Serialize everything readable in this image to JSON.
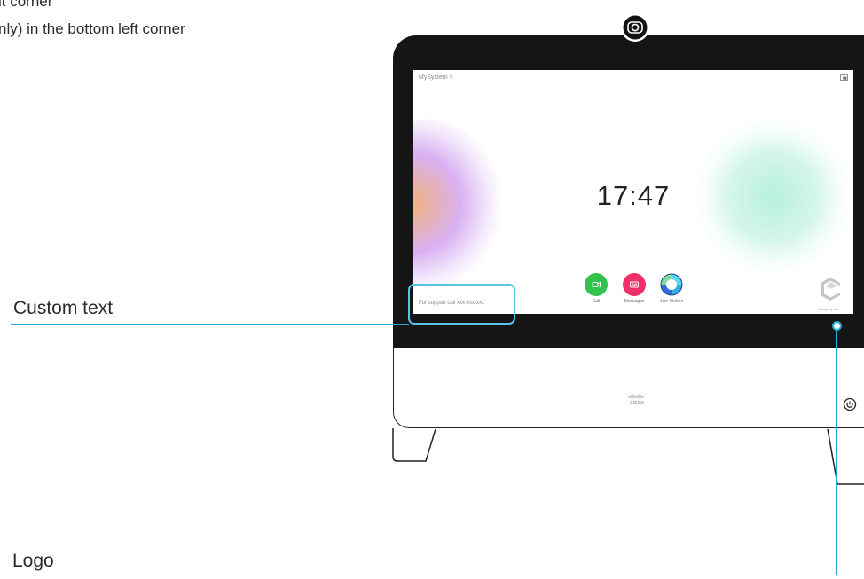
{
  "intro": {
    "line1": "lt corner",
    "line2": "nly) in the bottom left corner"
  },
  "callouts": {
    "custom_text": "Custom text",
    "logo": "Logo"
  },
  "screen": {
    "device_name": "MySystem >",
    "clock": "17:47",
    "actions": [
      {
        "label": "Call",
        "color": "#33c24c",
        "icon": "video-camera-icon"
      },
      {
        "label": "Messages",
        "color": "#f0306a",
        "icon": "voicemail-icon"
      },
      {
        "label": "Join Webex",
        "color": "#2a5dc9",
        "icon": "webex-icon"
      }
    ],
    "custom_text": "For support call xxx-xxx-xxx",
    "logo_text": "Company Inc."
  },
  "device": {
    "brand": "cisco"
  },
  "colors": {
    "accent_line": "#29a9d8",
    "bezel": "#151515"
  }
}
